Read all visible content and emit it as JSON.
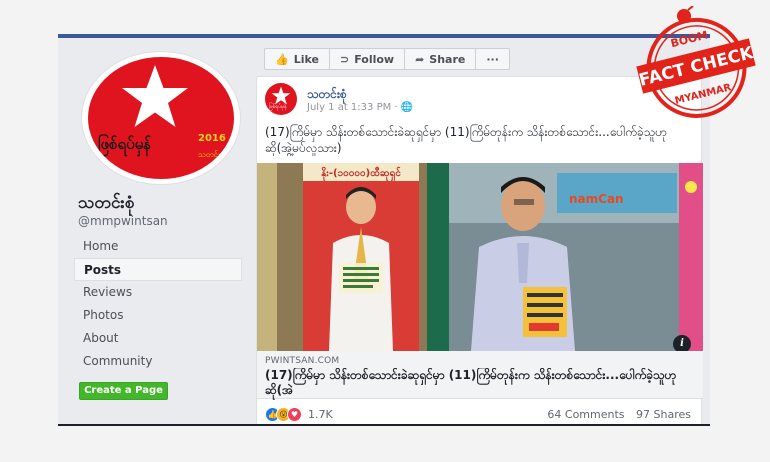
{
  "sidebar": {
    "page_name": "သတင်းစုံ",
    "handle": "@mmpwintsan",
    "nav": [
      "Home",
      "Posts",
      "Reviews",
      "Photos",
      "About",
      "Community"
    ],
    "active": "Posts",
    "cta": "Create a Page",
    "profile_logo_text": "ဖြစ်ရပ်မှန်",
    "profile_logo_year": "2016",
    "profile_logo_sub": "သတင်း"
  },
  "actions": {
    "like": "Like",
    "follow": "Follow",
    "share": "Share",
    "more": "···"
  },
  "post": {
    "author": "သတင်းစုံ",
    "time": "July 1 at 1:33 PM · 🌐",
    "text": "(17)ကြိမ်မှာ သိန်းတစ်သောင်းခဲဆုရှင်မှာ (11)ကြိမ်တုန်းက သိန်းတစ်သောင်း...ပေါက်ခဲ့သူဟုဆို(အွဲ့မပ်လူသား)",
    "more": "...",
    "link_domain": "PWINTSAN.COM",
    "link_title": "(17)ကြိမ်မှာ သိန်းတစ်သောင်းခဲဆုရှင်မှာ (11)ကြိမ်တုန်းက သိန်းတစ်သောင်း...ပေါက်ခဲ့သူဟုဆို(အဲ",
    "reaction_count": "1.7K",
    "comments": "64 Comments",
    "shares": "97 Shares",
    "banner_text": "နိုး-(၁၀၀၀၀)ထီဆုရှင်",
    "shop_sign": "namCan"
  },
  "stamp": {
    "top": "BOOM",
    "middle": "FACT CHECK",
    "bottom": "MYANMAR"
  },
  "colors": {
    "fb_blue": "#3b5998",
    "stamp_red": "#e2231a",
    "party_red": "#e0141e",
    "cta_green": "#42b72a"
  }
}
